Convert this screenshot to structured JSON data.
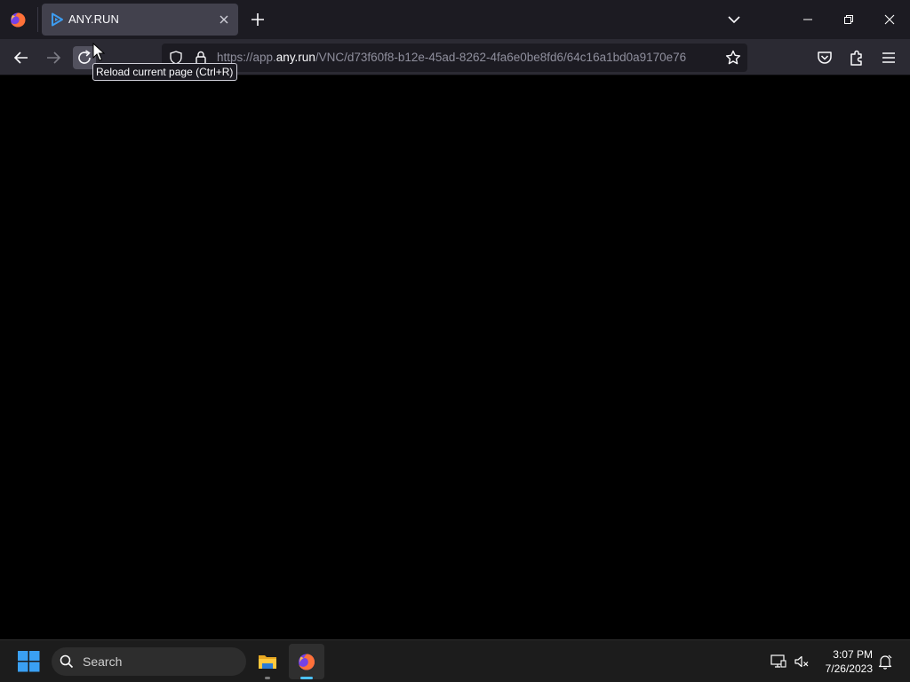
{
  "browser": {
    "tab": {
      "title": "ANY.RUN",
      "close_label": "Close tab"
    },
    "new_tab_label": "New tab",
    "url": {
      "scheme_prefix": "https://app.",
      "host": "any.run",
      "path": "/VNC/d73f60f8-b12e-45ad-8262-4fa6e0be8fd6/64c16a1bd0a9170e76"
    },
    "tooltip": "Reload current page (Ctrl+R)"
  },
  "taskbar": {
    "search_label": "Search",
    "clock_time": "3:07 PM",
    "clock_date": "7/26/2023"
  },
  "colors": {
    "tab_strip": "#1c1b22",
    "toolbar": "#2b2a33",
    "active_tab": "#42414d",
    "taskbar": "#1c1c1c",
    "accent": "#4cc2ff"
  }
}
